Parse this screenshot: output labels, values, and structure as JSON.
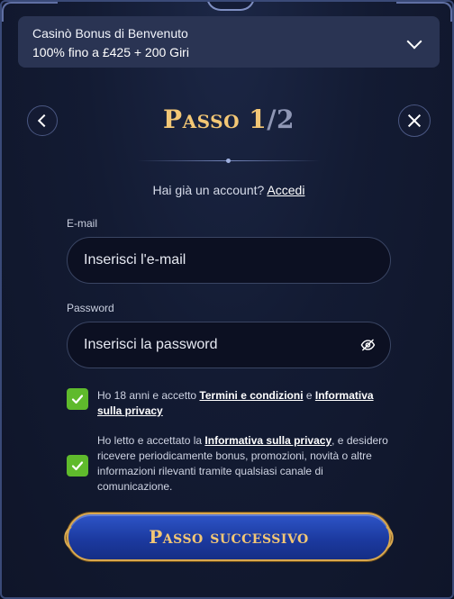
{
  "bonus": {
    "title": "Casinò Bonus di Benvenuto",
    "subtitle": "100% fino a £425 + 200 Giri"
  },
  "step": {
    "title_word": "Passo",
    "current": "1",
    "total": "/2"
  },
  "login": {
    "prompt": "Hai già un account?",
    "link": "Accedi"
  },
  "email": {
    "label": "E-mail",
    "placeholder": "Inserisci l'e-mail",
    "value": ""
  },
  "password": {
    "label": "Password",
    "placeholder": "Inserisci la password",
    "value": ""
  },
  "consent_age": {
    "checked": true,
    "text_before": "Ho 18 anni e accetto ",
    "terms_link": "Termini e condizioni",
    "text_and": " e ",
    "privacy_link": "Informativa sulla privacy"
  },
  "consent_marketing": {
    "checked": true,
    "text_before": "Ho letto e accettato la ",
    "privacy_link": "Informativa sulla privacy",
    "text_after": ", e desidero ricevere periodicamente bonus, promozioni, novità o altre informazioni rilevanti tramite qualsiasi canale di comunicazione."
  },
  "next_button": {
    "label": "Passo successivo"
  },
  "icons": {
    "bonus_toggle": "chevron-down-icon",
    "back": "chevron-left-icon",
    "close": "close-icon",
    "password_visibility": "eye-off-icon",
    "checkbox": "checkmark-icon"
  },
  "colors": {
    "background": "#131b33",
    "accent_gold": "#f3c775",
    "checkbox_green": "#5fba2c",
    "button_blue": "#1c3aa0"
  }
}
